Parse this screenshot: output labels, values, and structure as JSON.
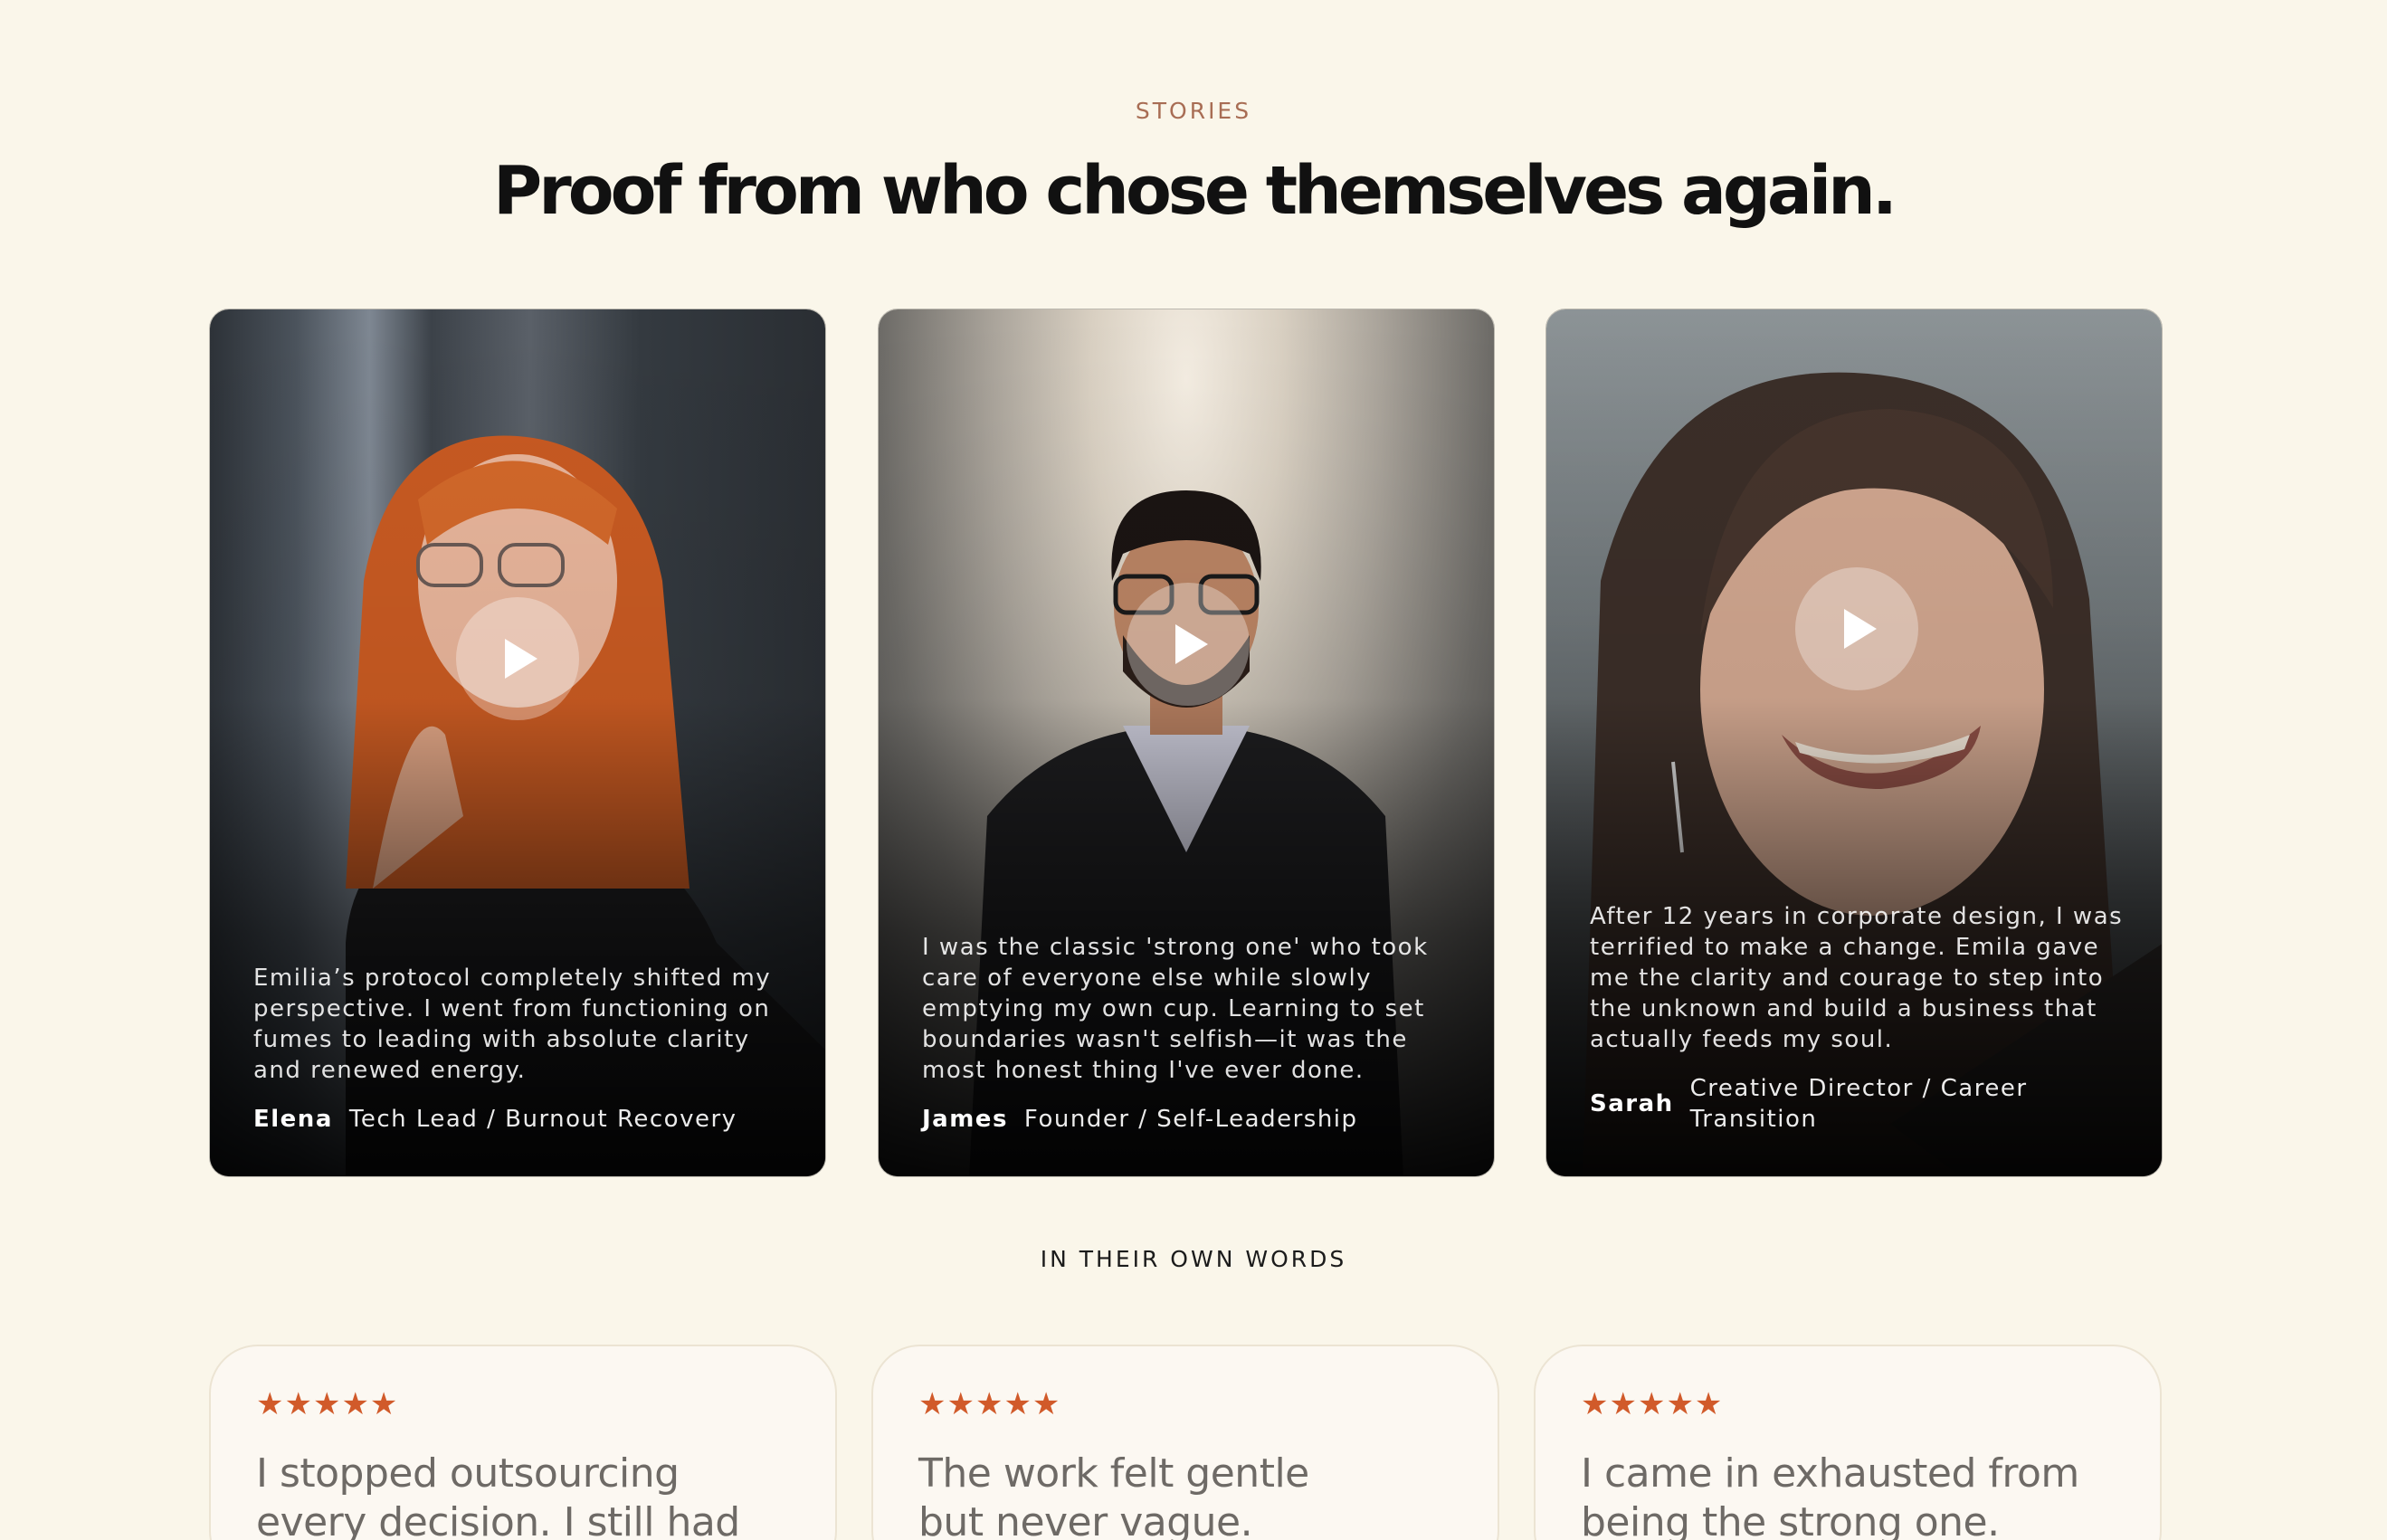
{
  "section": {
    "eyebrow": "STORIES",
    "headline": "Proof from who chose themselves again."
  },
  "video_cards": [
    {
      "quote": "Emilia’s protocol completely shifted my perspective. I went from functioning on fumes to leading with absolute clarity and renewed energy.",
      "name": "Elena",
      "role": "Tech Lead / Burnout Recovery"
    },
    {
      "quote": "I was the classic 'strong one' who took care of everyone else while slowly emptying my own cup. Learning to set boundaries wasn't selfish—it was the most honest thing I've ever done.",
      "name": "James",
      "role": "Founder /  Self-Leadership"
    },
    {
      "quote": "After 12 years in corporate design, I was terrified to make a change. Emila gave me the clarity and courage to step into the unknown and build a business that actually feeds my soul.",
      "name": "Sarah",
      "role": "Creative Director / Career Transition"
    }
  ],
  "reviews_section": {
    "eyebrow": "IN THEIR OWN WORDS"
  },
  "reviews": [
    {
      "stars": "★★★★★",
      "text": "I stopped outsourcing every decision. I still had fear,"
    },
    {
      "stars": "★★★★★",
      "text": "The work felt gentle but never vague. Each"
    },
    {
      "stars": "★★★★★",
      "text": "I came in exhausted from being the strong one."
    }
  ],
  "icons": {
    "play": "play-icon",
    "star": "star-icon"
  },
  "colors": {
    "background": "#faf6ea",
    "eyebrow": "#a86d54",
    "headline": "#111111",
    "star": "#d15a2a",
    "review_text": "#6e6a66"
  }
}
